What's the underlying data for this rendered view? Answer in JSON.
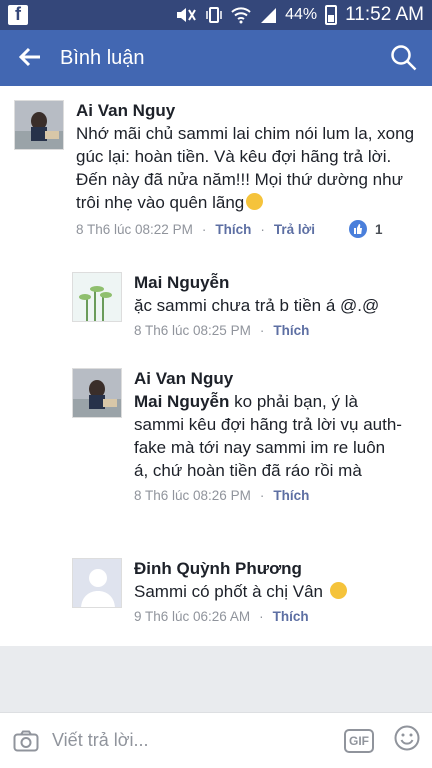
{
  "status_bar": {
    "battery": "44%",
    "time": "11:52 AM"
  },
  "header": {
    "title": "Bình luận"
  },
  "comments": [
    {
      "author": "Ai Van Nguy",
      "text": "Nhớ mãi chủ sammi lai chim nói lum la, xong gúc lại: hoàn tiền. Và kêu đợi hãng trả lời. Đến này đã nửa năm!!! Mọi thứ dường như trôi nhẹ vào quên lãng",
      "time": "8 Th6 lúc 08:22 PM",
      "like": "Thích",
      "reply": "Trả lời",
      "likes": "1"
    },
    {
      "author": "Mai Nguyễn",
      "text": "ặc sammi chưa trả b tiền á @.@",
      "time": "8 Th6 lúc 08:25 PM",
      "like": "Thích"
    },
    {
      "author": "Ai Van Nguy",
      "mention": "Mai Nguyễn",
      "text": "ko phải bạn, ý là sammi kêu đợi hãng trả lời vụ auth-fake mà tới nay sammi im re luôn á, chứ hoàn tiền đã ráo rồi mà",
      "time": "8 Th6 lúc 08:26 PM",
      "like": "Thích"
    },
    {
      "author": "Đinh Quỳnh Phương",
      "text": "Sammi có phốt à chị Vân",
      "time": "9 Th6 lúc 06:26 AM",
      "like": "Thích"
    }
  ],
  "composer": {
    "placeholder": "Viết trả lời...",
    "gif_label": "GIF"
  }
}
